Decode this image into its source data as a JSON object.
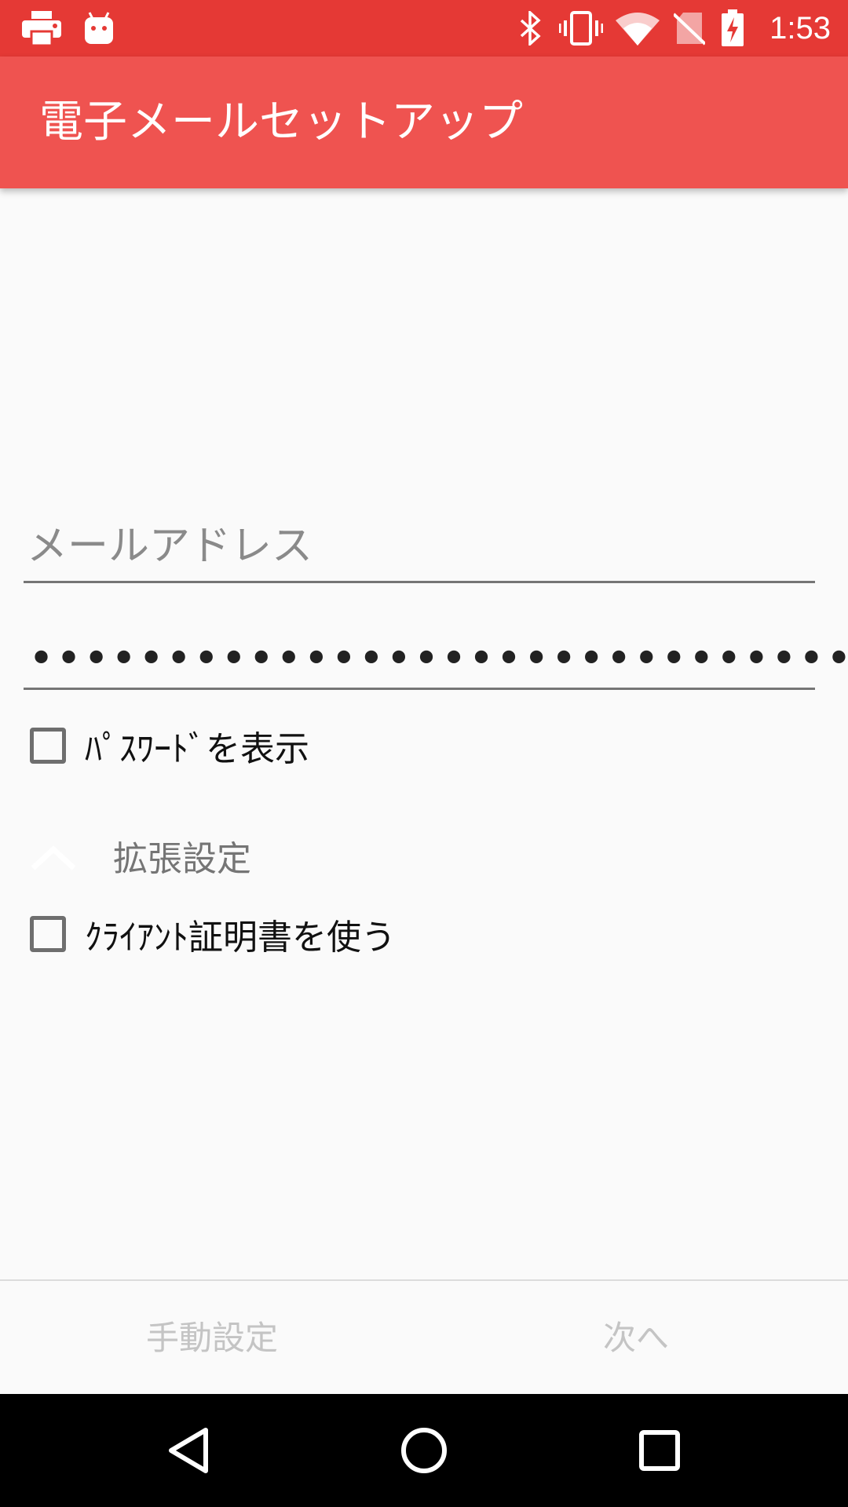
{
  "status_bar": {
    "time": "1:53",
    "left_icons": [
      "print-icon",
      "android-icon"
    ],
    "right_icons": [
      "bluetooth-icon",
      "vibrate-icon",
      "wifi-icon",
      "no-sim-icon",
      "battery-charging-icon"
    ],
    "background": "#e53935"
  },
  "app_bar": {
    "title": "電子メールセットアップ",
    "background": "#ef5350"
  },
  "form": {
    "email_placeholder": "メールアドレス",
    "password_masked": "••••••••••••••••••••••••••••••",
    "show_password_label": "ﾊﾟｽﾜｰﾄﾞを表示",
    "show_password_checked": false,
    "advanced_label": "拡張設定",
    "advanced_icon": "chevron-up-icon",
    "client_cert_label": "ｸﾗｲｱﾝﾄ証明書を使う",
    "client_cert_checked": false
  },
  "buttons": {
    "manual_setup": "手動設定",
    "next": "次へ"
  },
  "nav_bar": {
    "icons": [
      "back-icon",
      "home-icon",
      "recents-icon"
    ]
  }
}
